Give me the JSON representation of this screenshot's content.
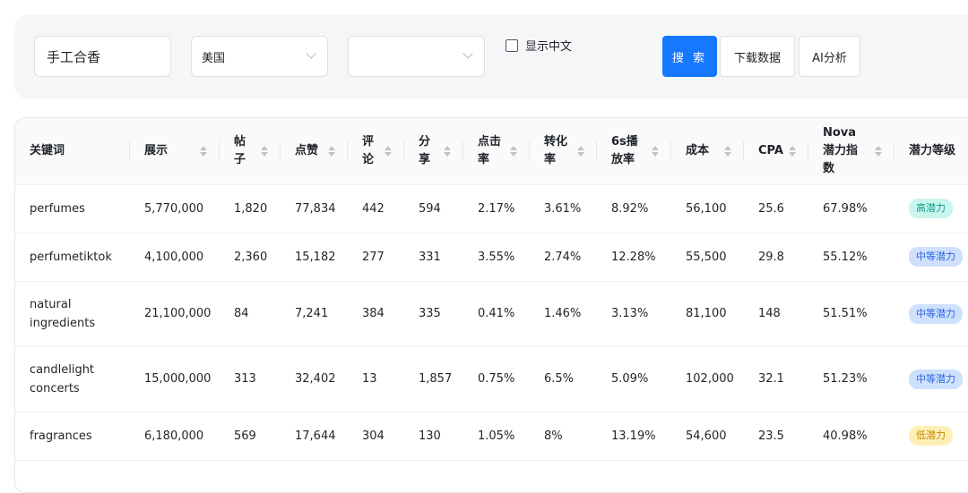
{
  "search": {
    "keyword_value": "手工合香",
    "country": "美国",
    "second_select": "",
    "show_chinese_label": "显示中文",
    "search_button": "搜 索",
    "download_button": "下载数据",
    "ai_button": "AI分析"
  },
  "table": {
    "columns": {
      "keyword": "关键词",
      "impressions": "展示",
      "posts": "帖子",
      "likes": "点赞",
      "comments": "评论",
      "shares": "分享",
      "ctr": "点击率",
      "cvr": "转化率",
      "play6s": "6s播放率",
      "cost": "成本",
      "cpa": "CPA",
      "nova": "Nova潜力指数",
      "level": "潜力等级"
    },
    "rows": [
      {
        "keyword": "perfumes",
        "impressions": "5,770,000",
        "posts": "1,820",
        "likes": "77,834",
        "comments": "442",
        "shares": "594",
        "ctr": "2.17%",
        "cvr": "3.61%",
        "play6s": "8.92%",
        "cost": "56,100",
        "cpa": "25.6",
        "nova": "67.98%",
        "level": "高潜力",
        "level_type": "high"
      },
      {
        "keyword": "perfumetiktok",
        "impressions": "4,100,000",
        "posts": "2,360",
        "likes": "15,182",
        "comments": "277",
        "shares": "331",
        "ctr": "3.55%",
        "cvr": "2.74%",
        "play6s": "12.28%",
        "cost": "55,500",
        "cpa": "29.8",
        "nova": "55.12%",
        "level": "中等潜力",
        "level_type": "mid"
      },
      {
        "keyword": "natural ingredients",
        "impressions": "21,100,000",
        "posts": "84",
        "likes": "7,241",
        "comments": "384",
        "shares": "335",
        "ctr": "0.41%",
        "cvr": "1.46%",
        "play6s": "3.13%",
        "cost": "81,100",
        "cpa": "148",
        "nova": "51.51%",
        "level": "中等潜力",
        "level_type": "mid"
      },
      {
        "keyword": "candlelight concerts",
        "impressions": "15,000,000",
        "posts": "313",
        "likes": "32,402",
        "comments": "13",
        "shares": "1,857",
        "ctr": "0.75%",
        "cvr": "6.5%",
        "play6s": "5.09%",
        "cost": "102,000",
        "cpa": "32.1",
        "nova": "51.23%",
        "level": "中等潜力",
        "level_type": "mid"
      },
      {
        "keyword": "fragrances",
        "impressions": "6,180,000",
        "posts": "569",
        "likes": "17,644",
        "comments": "304",
        "shares": "130",
        "ctr": "1.05%",
        "cvr": "8%",
        "play6s": "13.19%",
        "cost": "54,600",
        "cpa": "23.5",
        "nova": "40.98%",
        "level": "低潜力",
        "level_type": "low"
      }
    ]
  },
  "colors": {
    "primary": "#1677ff",
    "badge_high": "#c9f5ef",
    "badge_mid": "#cfe0fd",
    "badge_low": "#fdf0b6"
  },
  "icons": {
    "select_arrow": "chevron-down-icon",
    "sort": "sort-icon",
    "checkbox": "checkbox-icon"
  }
}
